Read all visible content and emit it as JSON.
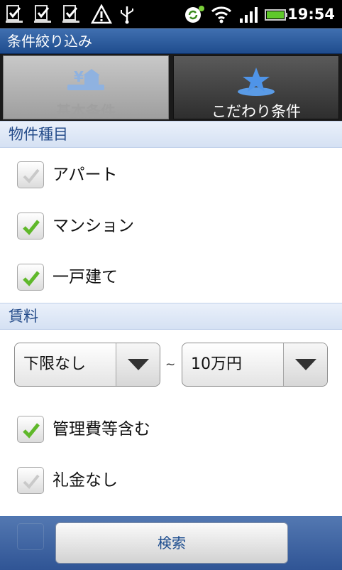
{
  "status_bar": {
    "time": "19:54",
    "icons": [
      "notification-check-icon",
      "notification-check-icon",
      "notification-check-icon",
      "warning-icon",
      "usb-icon",
      "sync-icon",
      "wifi-icon",
      "signal-icon",
      "battery-icon"
    ]
  },
  "title_bar": {
    "title": "条件絞り込み"
  },
  "tabs": [
    {
      "label": "基本条件",
      "icon": "yen-house-icon",
      "selected": true
    },
    {
      "label": "こだわり条件",
      "icon": "star-icon",
      "selected": false
    }
  ],
  "property_type": {
    "header": "物件種目",
    "items": [
      {
        "label": "アパート",
        "checked": false
      },
      {
        "label": "マンション",
        "checked": true
      },
      {
        "label": "一戸建て",
        "checked": true
      }
    ]
  },
  "rent": {
    "header": "賃料",
    "min_value": "下限なし",
    "separator": "~",
    "max_value": "10万円",
    "options": [
      {
        "label": "管理費等含む",
        "checked": true
      },
      {
        "label": "礼金なし",
        "checked": false
      }
    ]
  },
  "bottom_bar": {
    "search_label": "検索"
  },
  "colors": {
    "accent": "#1f4c8e",
    "check_green": "#5fb82a",
    "section_text": "#254c8a"
  }
}
